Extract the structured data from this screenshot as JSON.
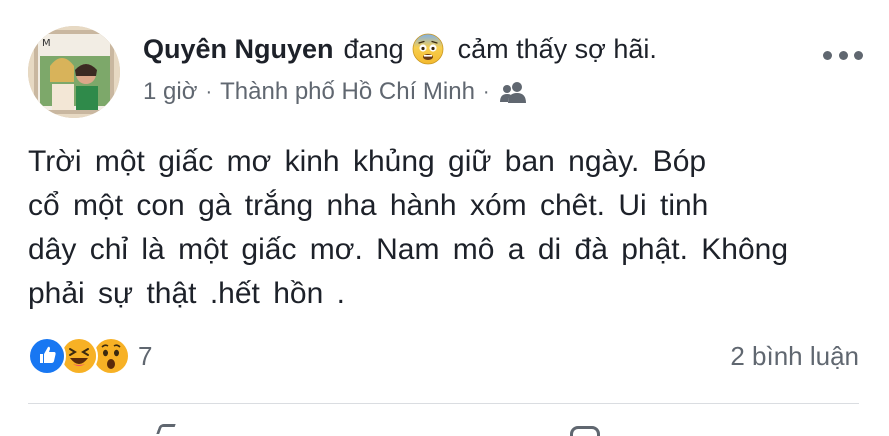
{
  "post": {
    "author": {
      "name": "Quyên Nguyen",
      "activity_verb": "đang",
      "feeling_icon": "fearful-face-emoji-icon",
      "activity_text": "cảm thấy sợ hãi."
    },
    "meta": {
      "time": "1 giờ",
      "separator": "·",
      "location": "Thành phố Hồ Chí Minh",
      "audience_icon": "friends-icon"
    },
    "text_lines": [
      "Trời một giấc mơ kinh khủng giữ ban ngày. Bóp",
      "cổ một con gà trắng nha hành xóm chêt. Ui tinh",
      "dây chỉ là một giấc mơ. Nam mô a di đà phật. Không",
      "phải sự thật .hết hồn ."
    ],
    "reactions": {
      "icons": [
        "like-reaction-icon",
        "haha-reaction-icon",
        "wow-reaction-icon"
      ],
      "count": "7"
    },
    "comments": {
      "label": "2 bình luận"
    },
    "colors": {
      "text": "#1d2129",
      "secondary": "#606770",
      "like_blue": "#1877f2",
      "emoji_yellow": "#f7b125"
    }
  }
}
